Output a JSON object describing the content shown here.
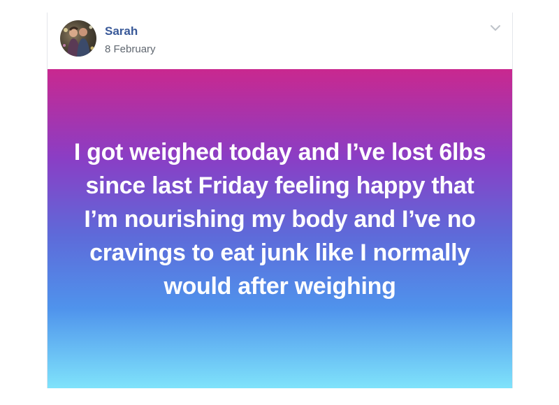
{
  "post": {
    "author": "Sarah",
    "date": "8 February",
    "status_text": "I got weighed today and I’ve lost 6lbs since last Friday feeling happy that I’m nourishing my body and I’ve no cravings to eat junk like I normally would after weighing"
  },
  "icons": {
    "menu": "chevron-down-icon",
    "avatar": "profile-photo"
  },
  "colors": {
    "author_name": "#385898",
    "gradient_top": "#c9288f",
    "gradient_bottom": "#7fe3fb"
  }
}
